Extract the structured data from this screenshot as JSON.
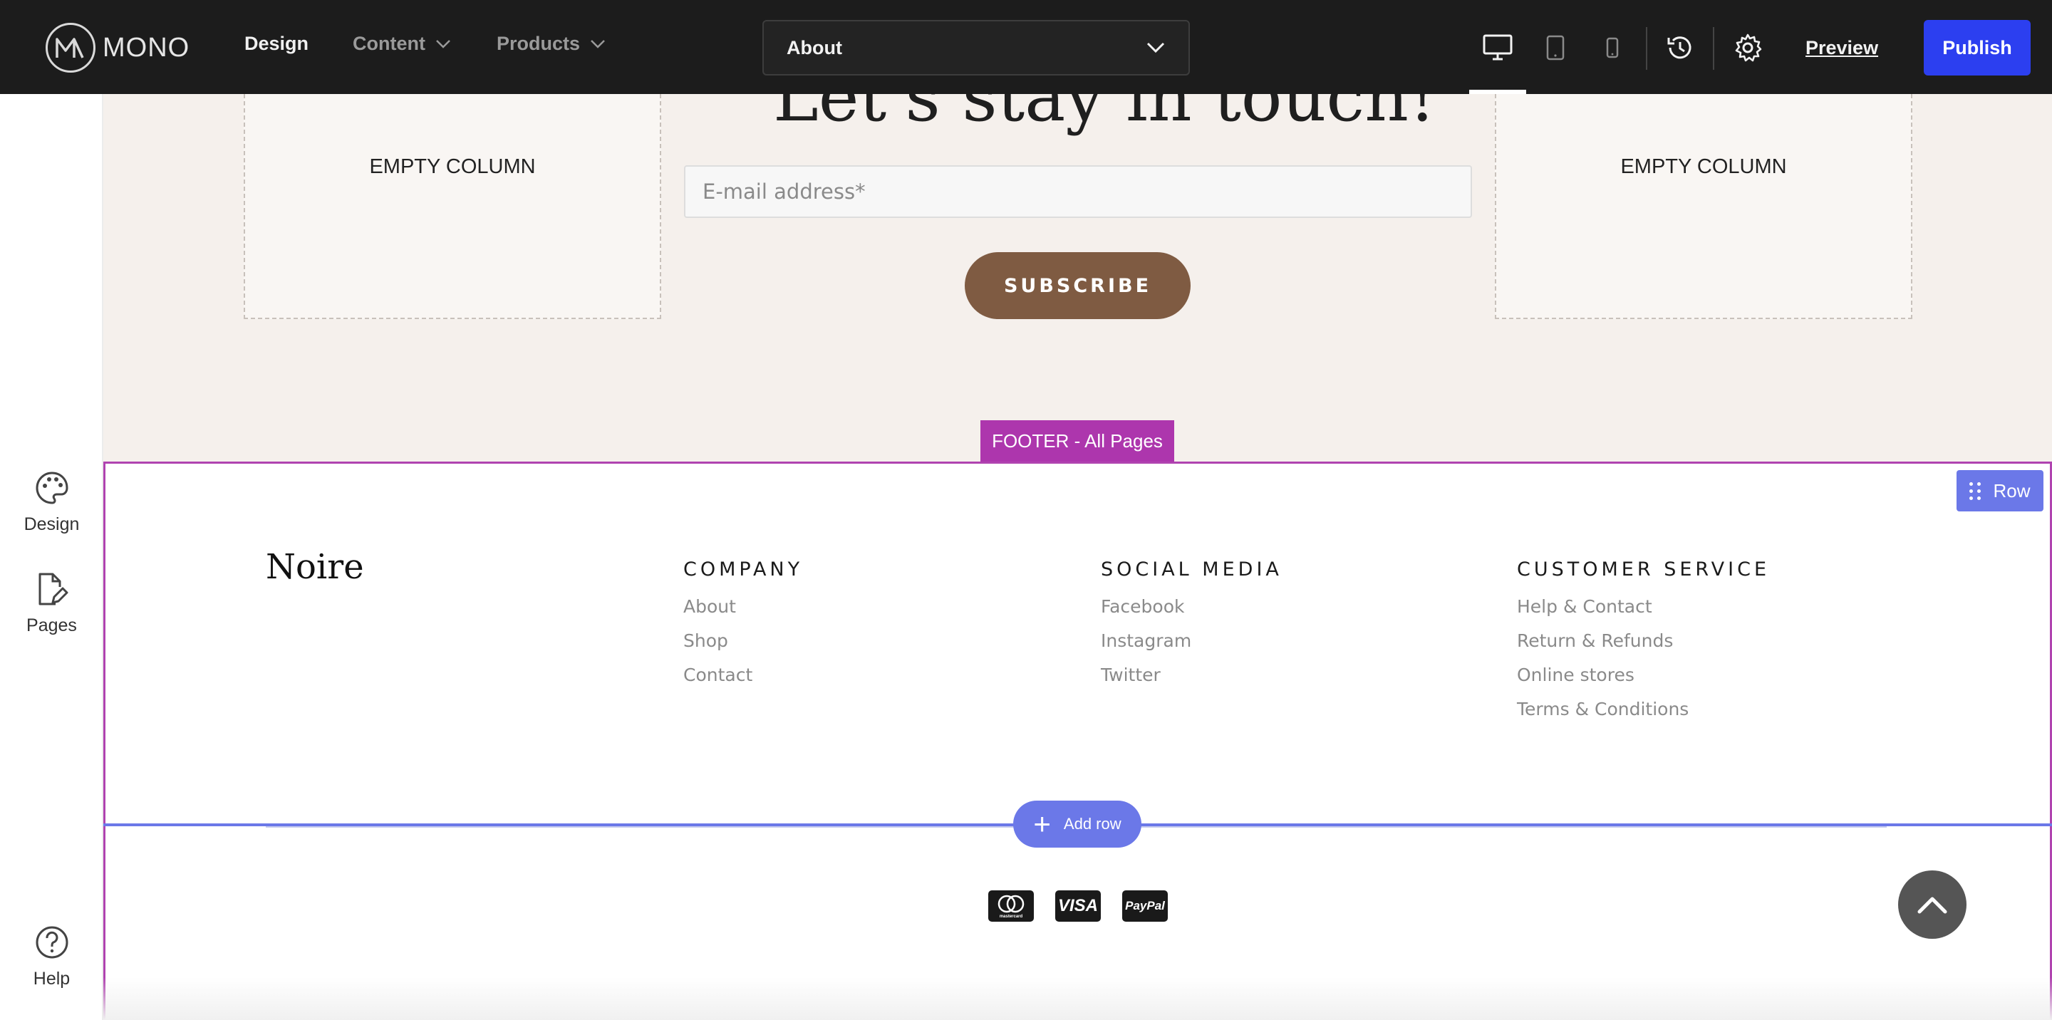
{
  "app": {
    "logo_text": "MONO",
    "nav": [
      {
        "label": "Design",
        "active": true
      },
      {
        "label": "Content",
        "has_dropdown": true
      },
      {
        "label": "Products",
        "has_dropdown": true
      }
    ],
    "page_selector": {
      "value": "About"
    },
    "toolbar_icons": [
      "desktop-icon",
      "tablet-icon",
      "mobile-icon",
      "history-icon",
      "settings-icon"
    ],
    "preview_label": "Preview",
    "publish_label": "Publish",
    "colors": {
      "topbar": "#1c1c1c",
      "publish": "#2c3ff0",
      "footer_outline": "#b043b0",
      "row_accent": "#6b78e8"
    }
  },
  "sidebar": {
    "items": [
      {
        "label": "Design",
        "icon": "palette-icon"
      },
      {
        "label": "Pages",
        "icon": "page-edit-icon"
      },
      {
        "label": "Help",
        "icon": "help-icon"
      }
    ]
  },
  "newsletter": {
    "headline": "Let's stay in touch!",
    "empty_column_label": "EMPTY COLUMN",
    "email_placeholder": "E-mail address*",
    "subscribe_label": "SUBSCRIBE"
  },
  "footer": {
    "tag": "FOOTER - All Pages",
    "row_badge": "Row",
    "brand": "Noire",
    "columns": [
      {
        "heading": "COMPANY",
        "links": [
          "About",
          "Shop",
          "Contact"
        ]
      },
      {
        "heading": "SOCIAL MEDIA",
        "links": [
          "Facebook",
          "Instagram",
          "Twitter"
        ]
      },
      {
        "heading": "CUSTOMER SERVICE",
        "links": [
          "Help & Contact",
          "Return & Refunds",
          "Online stores",
          "Terms & Conditions"
        ]
      }
    ],
    "add_row_label": "Add row",
    "payment_icons": [
      {
        "name": "mastercard-icon",
        "text": "mastercard"
      },
      {
        "name": "visa-icon",
        "text": "VISA"
      },
      {
        "name": "paypal-icon",
        "text": "PayPal"
      }
    ]
  }
}
